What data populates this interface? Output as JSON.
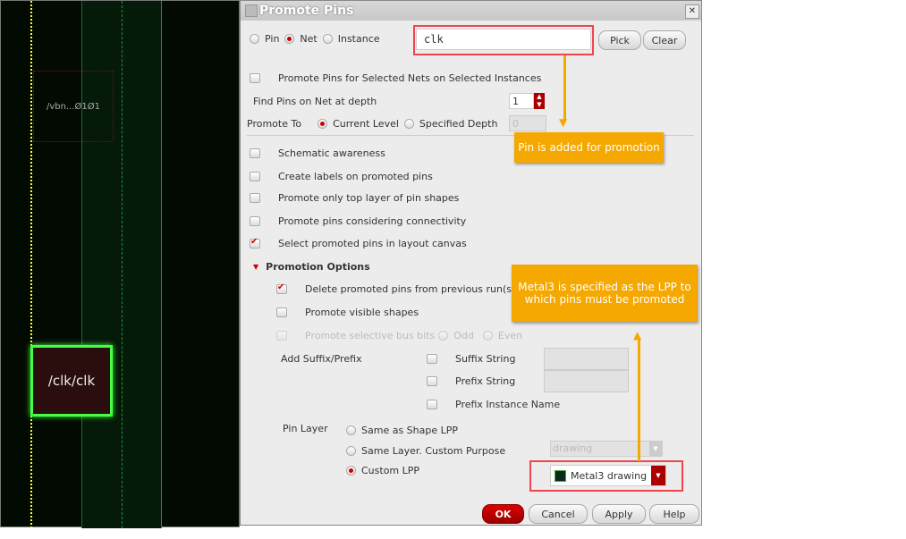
{
  "canvas": {
    "label_vbn": "/vbn...Ø1Ø1",
    "label_clk": "/clk/clk"
  },
  "dialog": {
    "title": "Promote Pins",
    "close": "✕",
    "mode": {
      "options": [
        "Pin",
        "Net",
        "Instance"
      ],
      "selected": "Net"
    },
    "net_value": "clk",
    "pick": "Pick",
    "clear": "Clear",
    "promote_selected": "Promote Pins for Selected Nets on Selected Instances",
    "find_depth_label": "Find Pins on Net at depth",
    "find_depth_value": "1",
    "promote_to_label": "Promote To",
    "current_level": "Current Level",
    "specified_depth": "Specified Depth",
    "specified_depth_value": "0",
    "options": [
      {
        "label": "Schematic awareness",
        "checked": false
      },
      {
        "label": "Create labels on promoted pins",
        "checked": false
      },
      {
        "label": "Promote only top layer of pin shapes",
        "checked": false
      },
      {
        "label": "Promote pins considering connectivity",
        "checked": false
      },
      {
        "label": "Select promoted pins in layout canvas",
        "checked": true
      }
    ],
    "promotion_options": "Promotion Options",
    "delete_previous": "Delete promoted pins from previous run(s)",
    "promote_visible": "Promote visible shapes",
    "selective_bus": "Promote selective bus bits",
    "odd": "Odd",
    "even": "Even",
    "add_suffix_prefix": "Add Suffix/Prefix",
    "suffix_string": "Suffix String",
    "prefix_string": "Prefix String",
    "prefix_instance": "Prefix Instance Name",
    "pin_layer": "Pin Layer",
    "same_shape": "Same as Shape LPP",
    "same_layer": "Same Layer. Custom Purpose",
    "custom_lpp": "Custom LPP",
    "purpose_value": "drawing",
    "lpp_value": "Metal3 drawing",
    "ok": "OK",
    "cancel": "Cancel",
    "apply": "Apply",
    "help": "Help"
  },
  "callouts": {
    "pin_added": "Pin is added for promotion",
    "metal3": "Metal3 is specified as the LPP to which pins must be promoted"
  },
  "colors": {
    "accent": "#c00000",
    "callout": "#f5a800",
    "highlight": "#f0454f"
  }
}
